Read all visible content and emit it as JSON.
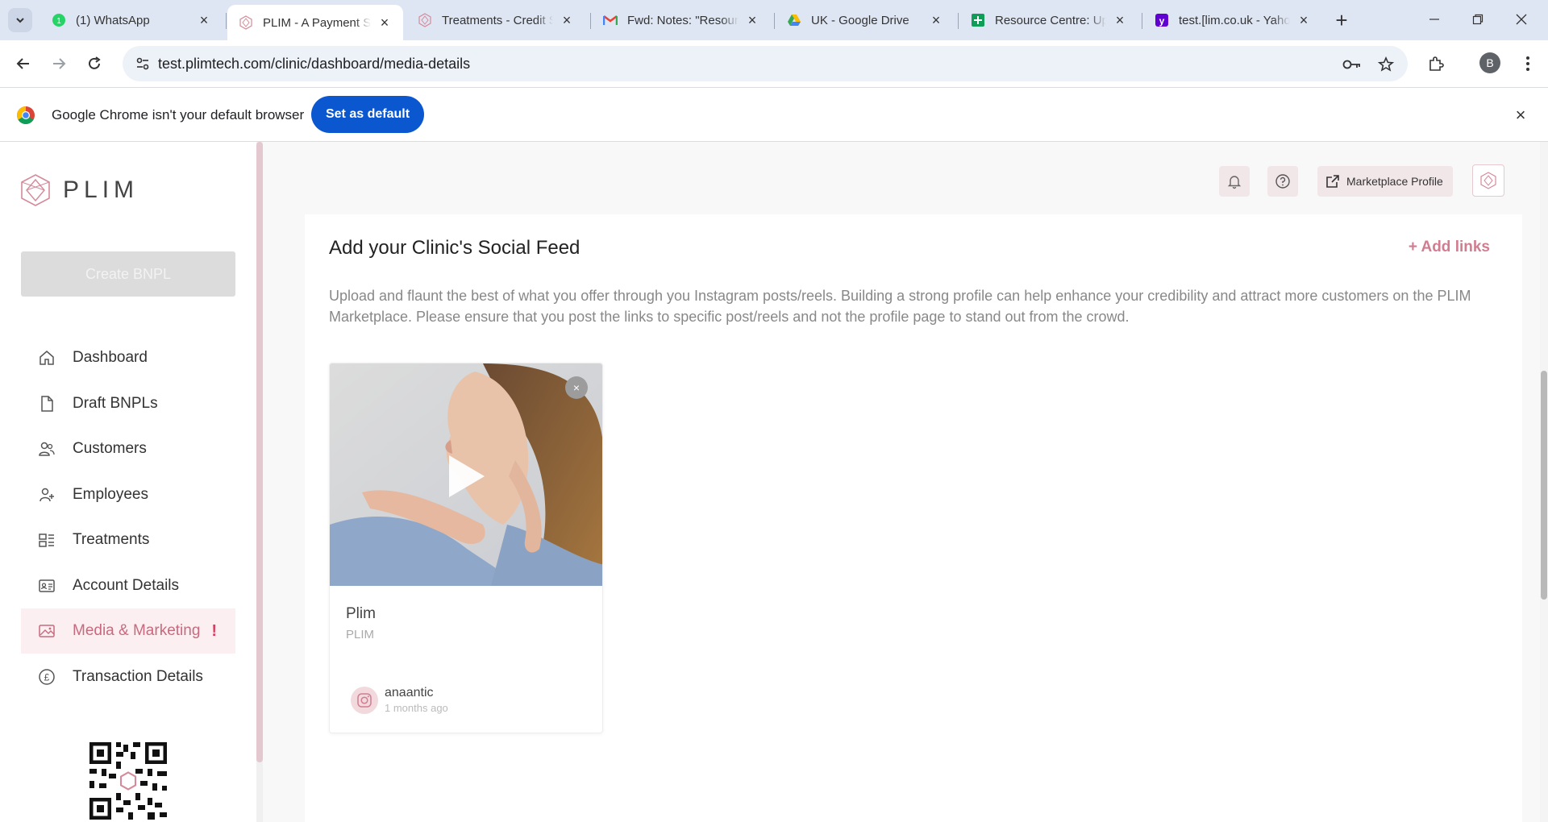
{
  "browser": {
    "tabs": [
      {
        "title": "(1) WhatsApp",
        "icon": "whatsapp-icon"
      },
      {
        "title": "PLIM - A Payment So",
        "icon": "plim-icon",
        "active": true
      },
      {
        "title": "Treatments - Credit S",
        "icon": "plim-icon"
      },
      {
        "title": "Fwd: Notes: \"Resource",
        "icon": "gmail-icon"
      },
      {
        "title": "UK - Google Drive",
        "icon": "google-drive-icon"
      },
      {
        "title": "Resource Centre: Up",
        "icon": "google-sheets-icon"
      },
      {
        "title": "test.[lim.co.uk - Yahoo",
        "icon": "yahoo-icon"
      }
    ],
    "url": "test.plimtech.com/clinic/dashboard/media-details",
    "profile_initial": "B",
    "infobar": {
      "message": "Google Chrome isn't your default browser",
      "button": "Set as default"
    }
  },
  "sidebar": {
    "logo_text": "PLIM",
    "create_button": "Create BNPL",
    "items": [
      {
        "label": "Dashboard",
        "icon": "home-icon"
      },
      {
        "label": "Draft BNPLs",
        "icon": "document-icon"
      },
      {
        "label": "Customers",
        "icon": "users-icon"
      },
      {
        "label": "Employees",
        "icon": "user-plus-icon"
      },
      {
        "label": "Treatments",
        "icon": "treatments-icon"
      },
      {
        "label": "Account Details",
        "icon": "id-card-icon"
      },
      {
        "label": "Media & Marketing",
        "icon": "image-icon",
        "active": true,
        "alert": "!"
      },
      {
        "label": "Transaction Details",
        "icon": "pound-icon"
      }
    ]
  },
  "header": {
    "marketplace_button": "Marketplace Profile"
  },
  "main": {
    "title": "Add your Clinic's Social Feed",
    "add_links": "+ Add links",
    "description": "Upload and flaunt the best of what you offer through you Instagram posts/reels. Building a strong profile can help enhance your credibility and attract more customers on the PLIM Marketplace. Please ensure that you post the links to specific post/reels and not the profile page to stand out from the crowd.",
    "posts": [
      {
        "title": "Plim",
        "subtitle": "PLIM",
        "author": "anaantic",
        "time": "1 months ago",
        "close_label": "×"
      }
    ]
  },
  "colors": {
    "accent": "#c86a7e",
    "accent_bg": "#fbeff1",
    "chrome_blue": "#0b57d0"
  }
}
